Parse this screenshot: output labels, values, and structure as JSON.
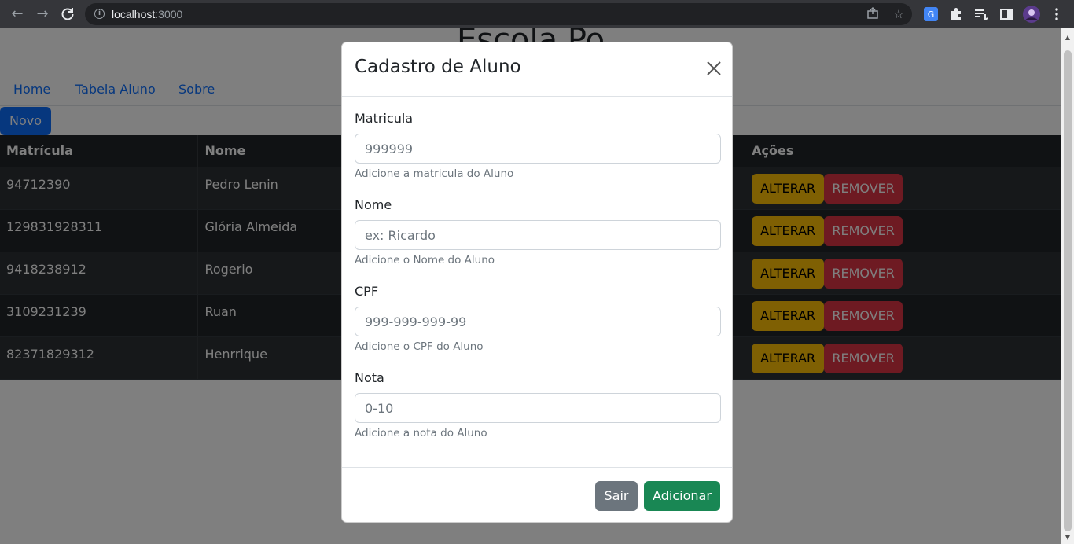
{
  "browser": {
    "url_host": "localhost",
    "url_port": ":3000"
  },
  "page": {
    "title": "Escola Po",
    "nav": [
      "Home",
      "Tabela Aluno",
      "Sobre"
    ],
    "new_button": "Novo",
    "table": {
      "headers": [
        "Matrícula",
        "Nome",
        "",
        "Ações"
      ],
      "rows": [
        {
          "matricula": "94712390",
          "nome": "Pedro Lenin"
        },
        {
          "matricula": "129831928311",
          "nome": "Glória Almeida"
        },
        {
          "matricula": "9418238912",
          "nome": "Rogerio"
        },
        {
          "matricula": "3109231239",
          "nome": "Ruan"
        },
        {
          "matricula": "82371829312",
          "nome": "Henrrique"
        }
      ],
      "alter_label": "ALTERAR",
      "remove_label": "REMOVER"
    }
  },
  "modal": {
    "title": "Cadastro de Aluno",
    "fields": [
      {
        "label": "Matricula",
        "placeholder": "999999",
        "help": "Adicione a matricula do Aluno"
      },
      {
        "label": "Nome",
        "placeholder": "ex: Ricardo",
        "help": "Adicione o Nome do Aluno"
      },
      {
        "label": "CPF",
        "placeholder": "999-999-999-99",
        "help": "Adicione o CPF do Aluno"
      },
      {
        "label": "Nota",
        "placeholder": "0-10",
        "help": "Adicione a nota do Aluno"
      }
    ],
    "cancel_label": "Sair",
    "submit_label": "Adicionar"
  },
  "colors": {
    "primary": "#0d6efd",
    "warning": "#ffc107",
    "danger": "#dc3545",
    "success": "#198754",
    "secondary": "#6c757d",
    "table_dark": "#212529"
  }
}
